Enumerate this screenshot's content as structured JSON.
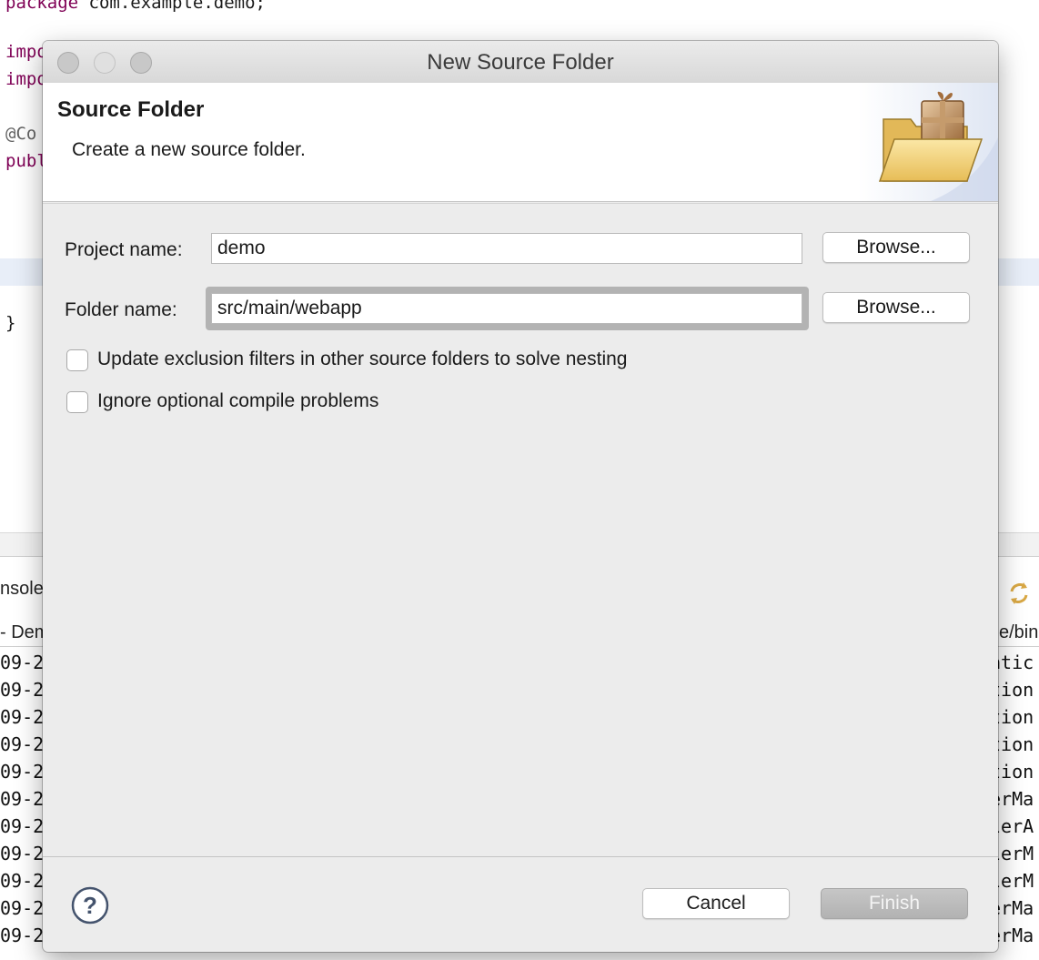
{
  "editor": {
    "lines": [
      {
        "kw": "package",
        "rest": " com.example.demo;"
      },
      {
        "kw": "impo",
        "rest": ""
      },
      {
        "kw": "impo",
        "rest": ""
      },
      {
        "anno": "@Co",
        "rest": ""
      },
      {
        "kw": "publ",
        "rest": ""
      },
      {
        "kw": "",
        "rest": "}"
      }
    ]
  },
  "console": {
    "tab_label": "nsole",
    "sub_left": "- Dem",
    "sub_right": "e/bin",
    "left_lines": [
      "09-2",
      "09-2",
      "09-2",
      "09-2",
      "09-2",
      "09-2",
      "09-2",
      "09-2",
      "09-2",
      "09-2",
      "09-2"
    ],
    "right_lines": [
      "atic",
      "tion",
      "tion",
      "tion",
      "tion",
      "erMa",
      "lerA",
      "lerM",
      "lerM",
      "erMa",
      "erMa"
    ]
  },
  "dialog": {
    "title": "New Source Folder",
    "banner_title": "Source Folder",
    "banner_message": "Create a new source folder.",
    "project_label": "Project name:",
    "project_value": "demo",
    "folder_label": "Folder name:",
    "folder_value": "src/main/webapp",
    "browse_label": "Browse...",
    "checkbox_exclusion": "Update exclusion filters in other source folders to solve nesting",
    "checkbox_ignore": "Ignore optional compile problems",
    "exclusion_checked": false,
    "ignore_checked": false,
    "cancel_label": "Cancel",
    "finish_label": "Finish",
    "finish_enabled": false
  },
  "icons": {
    "help": "help-icon",
    "banner": "folder-package-icon",
    "console_sync": "sync-icon"
  }
}
